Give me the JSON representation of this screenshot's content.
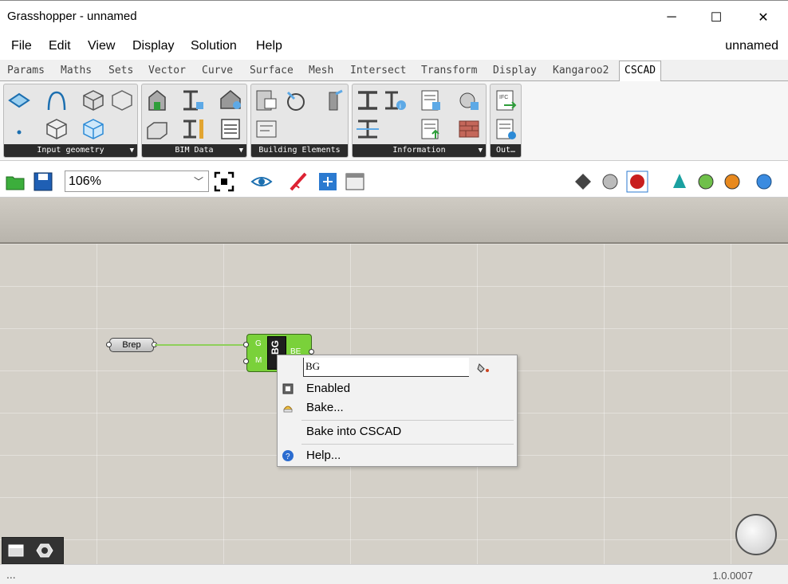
{
  "window": {
    "title": "Grasshopper - unnamed",
    "minimize": "─",
    "maximize": "☐",
    "close": "✕"
  },
  "menu": {
    "items": [
      "File",
      "Edit",
      "View",
      "Display",
      "Solution",
      "Help"
    ],
    "document_name": "unnamed"
  },
  "tabs": [
    "Params",
    "Maths",
    "Sets",
    "Vector",
    "Curve",
    "Surface",
    "Mesh",
    "Intersect",
    "Transform",
    "Display",
    "Kangaroo2",
    "CSCAD"
  ],
  "active_tab": "CSCAD",
  "ribbon": {
    "panels": [
      {
        "label": "Input geometry",
        "expander": "▼"
      },
      {
        "label": "BIM Data",
        "expander": "▼"
      },
      {
        "label": "Building Elements",
        "expander": ""
      },
      {
        "label": "Information",
        "expander": "▼"
      },
      {
        "label": "Out…",
        "expander": ""
      }
    ]
  },
  "toolbar": {
    "zoom": "106%",
    "zoom_dropdown": "﹀"
  },
  "canvas": {
    "param_node": {
      "label": "Brep"
    },
    "component": {
      "nickname": "BG",
      "inputs": [
        "G",
        "M"
      ],
      "outputs": [
        "BE"
      ]
    }
  },
  "context_menu": {
    "nickname_value": "BG",
    "items": {
      "enabled": "Enabled",
      "bake": "Bake...",
      "bake_cscad": "Bake into CSCAD",
      "help": "Help..."
    }
  },
  "statusbar": {
    "left": "...",
    "version": "1.0.0007"
  },
  "colors": {
    "component": "#7ad13a",
    "wire": "#8ecf5a",
    "canvas": "#d4d0c8",
    "panel_footer": "#2b2b2b"
  }
}
